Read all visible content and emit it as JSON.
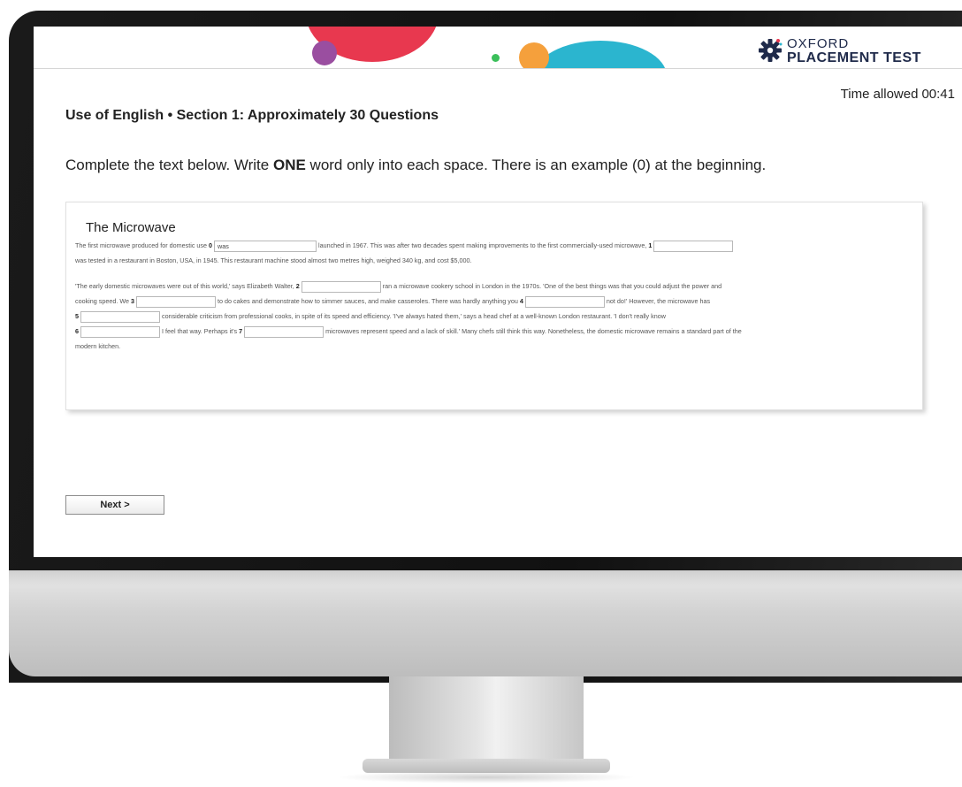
{
  "header": {
    "logo_line1": "OXFORD",
    "logo_line2": "PLACEMENT TEST"
  },
  "timer": {
    "label": "Time allowed",
    "value": "00:41"
  },
  "section_title": "Use of English • Section 1: Approximately 30 Questions",
  "instruction": {
    "before": "Complete the text below. Write ",
    "emphasis": "ONE",
    "after": " word only into each space. There is an example (0) at the beginning."
  },
  "passage": {
    "title": "The Microwave",
    "p1_a": "The first microwave produced for domestic use ",
    "q0_num": "0",
    "q0_value": "was",
    "p1_b": " launched in 1967. This was after two decades spent making improvements to the first commercially-used microwave, ",
    "q1_num": "1",
    "p1_c": "was tested in a restaurant in Boston, USA, in 1945. This restaurant machine stood almost two metres high, weighed 340 kg, and cost $5,000.",
    "p2_a": "'The early domestic microwaves were out of this world,' says Elizabeth Walter, ",
    "q2_num": "2",
    "p2_b": " ran a microwave cookery school in London in the 1970s. 'One of the best things was that you could adjust the power and",
    "p2_c": "cooking speed. We ",
    "q3_num": "3",
    "p2_d": " to do cakes and demonstrate how to simmer sauces, and make casseroles. There was hardly anything you ",
    "q4_num": "4",
    "p2_e": " not do!' However, the microwave has",
    "q5_num": "5",
    "p2_f": " considerable criticism from professional cooks, in spite of its speed and efficiency. 'I've always hated them,' says a head chef at a well-known London restaurant. 'I don't really know",
    "q6_num": "6",
    "p2_g": " I feel that way. Perhaps it's ",
    "q7_num": "7",
    "p2_h": " microwaves represent speed and a lack of skill.' Many chefs still think this way. Nonetheless, the domestic microwave remains a standard part of the",
    "p2_i": "modern kitchen."
  },
  "next_button": "Next >",
  "colors": {
    "accent_red": "#e8384f",
    "accent_teal": "#2bb5cf",
    "accent_orange": "#f5a03c",
    "accent_purple": "#9a4ea0",
    "logo_navy": "#1f2a4a"
  }
}
